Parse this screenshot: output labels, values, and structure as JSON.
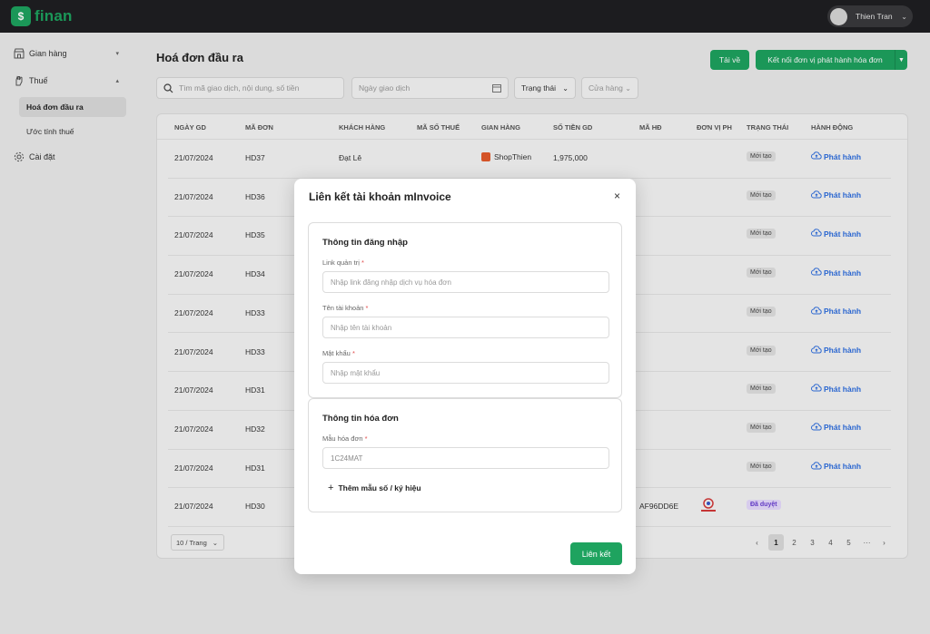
{
  "app": {
    "logo_glyph": "$",
    "name": "finan",
    "brand_color": "#1ea35f"
  },
  "user": {
    "name": "Thien Tran"
  },
  "sidebar": {
    "items": [
      {
        "label": "Gian hàng",
        "icon": "store-icon",
        "caret": "▾"
      },
      {
        "label": "Thuế",
        "icon": "hand-icon",
        "caret": "▴"
      },
      {
        "label": "Hoá đơn đầu ra",
        "active": true
      },
      {
        "label": "Ước tính thuế"
      },
      {
        "label": "Cài đặt",
        "icon": "gear-icon"
      }
    ]
  },
  "page": {
    "title": "Hoá đơn đầu ra"
  },
  "toolbar": {
    "download_label": "Tải về",
    "connect_label": "Kết nối đơn vị phát hành hóa đơn"
  },
  "filters": {
    "search_placeholder": "Tìm mã giao dịch, nội dung, số tiền",
    "date_placeholder": "Ngày giao dịch",
    "status_label": "Trạng thái",
    "store_label": "Cửa hàng"
  },
  "table": {
    "headers": [
      "NGÀY GD",
      "MÃ ĐƠN",
      "KHÁCH HÀNG",
      "MÃ SỐ THUẾ",
      "GIAN HÀNG",
      "SỐ TIỀN GD",
      "MÃ HĐ",
      "ĐƠN VỊ PH",
      "TRẠNG THÁI",
      "HÀNH ĐỘNG"
    ],
    "rows": [
      {
        "date": "21/07/2024",
        "order": "HD37",
        "customer": "Đạt Lê",
        "store": "ShopThien",
        "amount": "1,975,000",
        "invoice": "",
        "status": "Mới tạo",
        "action": "Phát hành"
      },
      {
        "date": "21/07/2024",
        "order": "HD36",
        "customer": "",
        "store": "",
        "amount": "",
        "invoice": "",
        "status": "Mới tạo",
        "action": "Phát hành"
      },
      {
        "date": "21/07/2024",
        "order": "HD35",
        "customer": "",
        "store": "",
        "amount": "",
        "invoice": "",
        "status": "Mới tạo",
        "action": "Phát hành"
      },
      {
        "date": "21/07/2024",
        "order": "HD34",
        "customer": "",
        "store": "",
        "amount": "",
        "invoice": "",
        "status": "Mới tạo",
        "action": "Phát hành"
      },
      {
        "date": "21/07/2024",
        "order": "HD33",
        "customer": "",
        "store": "",
        "amount": "",
        "invoice": "",
        "status": "Mới tạo",
        "action": "Phát hành"
      },
      {
        "date": "21/07/2024",
        "order": "HD33",
        "customer": "",
        "store": "",
        "amount": "",
        "invoice": "",
        "status": "Mới tạo",
        "action": "Phát hành"
      },
      {
        "date": "21/07/2024",
        "order": "HD31",
        "customer": "",
        "store": "",
        "amount": "",
        "invoice": "",
        "status": "Mới tạo",
        "action": "Phát hành"
      },
      {
        "date": "21/07/2024",
        "order": "HD32",
        "customer": "",
        "store": "",
        "amount": "",
        "invoice": "",
        "status": "Mới tạo",
        "action": "Phát hành"
      },
      {
        "date": "21/07/2024",
        "order": "HD31",
        "customer": "",
        "store": "",
        "amount": "",
        "invoice": "",
        "status": "Mới tạo",
        "action": "Phát hành"
      },
      {
        "date": "21/07/2024",
        "order": "HD30",
        "customer": "",
        "store": "",
        "amount": "",
        "invoice": "AF96DD6E",
        "status": "Đã duyệt",
        "action": ""
      }
    ]
  },
  "pagination": {
    "page_size": "10 / Trang",
    "pages": [
      "1",
      "2",
      "3",
      "4",
      "5",
      "···"
    ],
    "current": "1",
    "prev": "‹",
    "next": "›"
  },
  "modal": {
    "title": "Liên kết tài khoản mInvoice",
    "close": "×",
    "login_section_title": "Thông tin đăng nhập",
    "admin_link_label": "Link quản trị",
    "admin_link_placeholder": "Nhập link đăng nhập dịch vụ hóa đơn",
    "username_label": "Tên tài khoản",
    "username_placeholder": "Nhập tên tài khoản",
    "password_label": "Mật khẩu",
    "password_placeholder": "Nhập mật khẩu",
    "invoice_section_title": "Thông tin hóa đơn",
    "template_label": "Mẫu hóa đơn",
    "template_value": "1C24MAT",
    "add_template_label": "Thêm mẫu số / ký hiệu",
    "submit_label": "Liên kết",
    "required_mark": "*"
  }
}
